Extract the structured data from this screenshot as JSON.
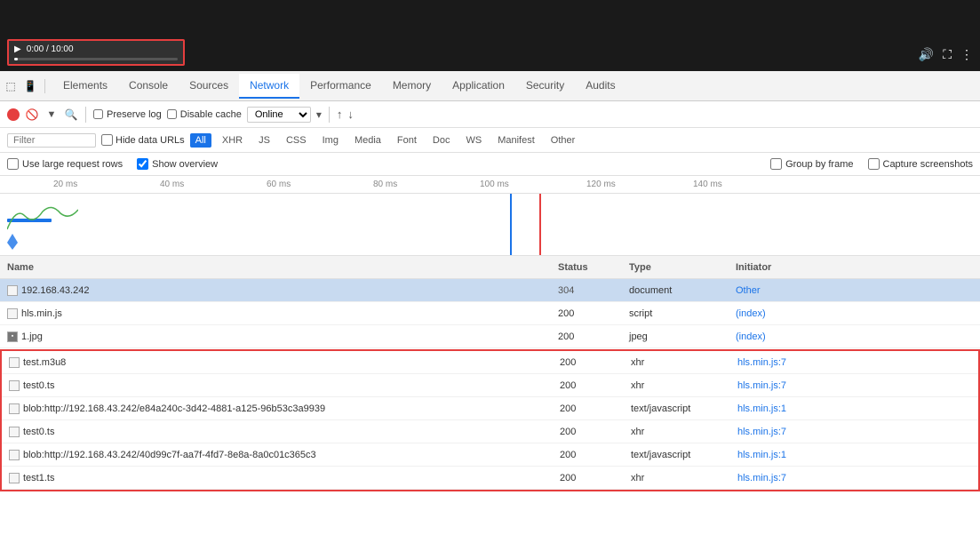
{
  "video": {
    "time": "0:00 / 10:00",
    "progress": 0
  },
  "devtools": {
    "tabs": [
      {
        "label": "Elements",
        "active": false
      },
      {
        "label": "Console",
        "active": false
      },
      {
        "label": "Sources",
        "active": false
      },
      {
        "label": "Network",
        "active": true
      },
      {
        "label": "Performance",
        "active": false
      },
      {
        "label": "Memory",
        "active": false
      },
      {
        "label": "Application",
        "active": false
      },
      {
        "label": "Security",
        "active": false
      },
      {
        "label": "Audits",
        "active": false
      }
    ],
    "toolbar": {
      "preserve_log": "Preserve log",
      "disable_cache": "Disable cache",
      "online": "Online",
      "upload_label": "↑",
      "download_label": "↓"
    },
    "filter": {
      "placeholder": "Filter",
      "hide_data_urls": "Hide data URLs",
      "types": [
        "All",
        "XHR",
        "JS",
        "CSS",
        "Img",
        "Media",
        "Font",
        "Doc",
        "WS",
        "Manifest",
        "Other"
      ],
      "active_type": "All"
    },
    "options": {
      "use_large_rows": "Use large request rows",
      "show_overview": "Show overview",
      "group_by_frame": "Group by frame",
      "capture_screenshots": "Capture screenshots"
    },
    "timeline": {
      "ticks": [
        "20 ms",
        "40 ms",
        "60 ms",
        "80 ms",
        "100 ms",
        "120 ms",
        "140 ms"
      ]
    },
    "table": {
      "headers": {
        "name": "Name",
        "status": "Status",
        "type": "Type",
        "initiator": "Initiator"
      },
      "rows": [
        {
          "name": "192.168.43.242",
          "status": "304",
          "type": "document",
          "initiator": "Other",
          "selected": true,
          "highlighted": false,
          "icon": "page"
        },
        {
          "name": "hls.min.js",
          "status": "200",
          "type": "script",
          "initiator": "(index)",
          "selected": false,
          "highlighted": false,
          "icon": "page"
        },
        {
          "name": "1.jpg",
          "status": "200",
          "type": "jpeg",
          "initiator": "(index)",
          "selected": false,
          "highlighted": false,
          "icon": "img"
        },
        {
          "name": "test.m3u8",
          "status": "200",
          "type": "xhr",
          "initiator": "hls.min.js:7",
          "selected": false,
          "highlighted": true,
          "icon": "page"
        },
        {
          "name": "test0.ts",
          "status": "200",
          "type": "xhr",
          "initiator": "hls.min.js:7",
          "selected": false,
          "highlighted": true,
          "icon": "page"
        },
        {
          "name": "blob:http://192.168.43.242/e84a240c-3d42-4881-a125-96b53c3a9939",
          "status": "200",
          "type": "text/javascript",
          "initiator": "hls.min.js:1",
          "selected": false,
          "highlighted": true,
          "icon": "page"
        },
        {
          "name": "test0.ts",
          "status": "200",
          "type": "xhr",
          "initiator": "hls.min.js:7",
          "selected": false,
          "highlighted": true,
          "icon": "page"
        },
        {
          "name": "blob:http://192.168.43.242/40d99c7f-aa7f-4fd7-8e8a-8a0c01c365c3",
          "status": "200",
          "type": "text/javascript",
          "initiator": "hls.min.js:1",
          "selected": false,
          "highlighted": true,
          "icon": "page"
        },
        {
          "name": "test1.ts",
          "status": "200",
          "type": "xhr",
          "initiator": "hls.min.js:7",
          "selected": false,
          "highlighted": true,
          "icon": "page"
        }
      ]
    }
  }
}
